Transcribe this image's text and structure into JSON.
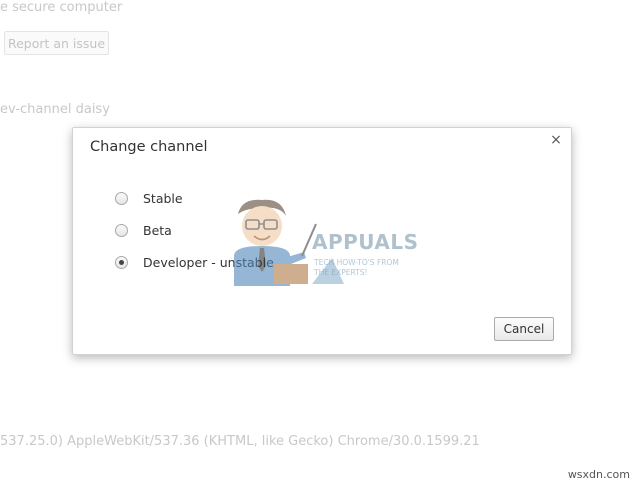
{
  "background": {
    "line1": "e secure computer",
    "report_button": "Report an issue",
    "channel_text": "ev-channel daisy",
    "user_agent": "537.25.0) AppleWebKit/537.36 (KHTML, like Gecko) Chrome/30.0.1599.21"
  },
  "dialog": {
    "title": "Change channel",
    "close_glyph": "×",
    "options": [
      {
        "label": "Stable",
        "checked": false
      },
      {
        "label": "Beta",
        "checked": false
      },
      {
        "label": "Developer - unstable",
        "checked": true
      }
    ],
    "cancel_label": "Cancel"
  },
  "watermark": {
    "logo_text": "APPUALS",
    "tagline": "TECH HOW-TO'S FROM THE EXPERTS!"
  },
  "site_mark": "wsxdn.com",
  "colors": {
    "accent": "#6f8fa6"
  }
}
